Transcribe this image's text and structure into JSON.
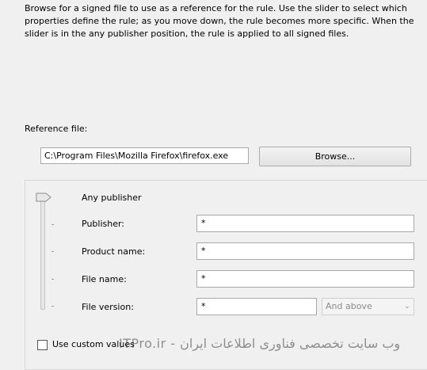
{
  "description": "Browse for a signed file to use as a reference for the rule. Use the slider to select which properties define the rule; as you move down, the rule becomes more specific. When the slider is in the any publisher position, the rule is applied to all signed files.",
  "reference": {
    "label": "Reference file:",
    "path": "C:\\Program Files\\Mozilla Firefox\\firefox.exe",
    "browse_label": "Browse..."
  },
  "slider": {
    "any_publisher_label": "Any publisher",
    "position": "Any publisher"
  },
  "rows": [
    {
      "label": "Publisher:",
      "value": "*"
    },
    {
      "label": "Product name:",
      "value": "*"
    },
    {
      "label": "File name:",
      "value": "*"
    },
    {
      "label": "File version:",
      "value": "*"
    }
  ],
  "version_combo": {
    "selected": "And above"
  },
  "custom_values": {
    "label": "Use custom values",
    "checked": false
  },
  "watermark": "ITPro.ir - وب سایت تخصصی فناوری اطلاعات ایران"
}
